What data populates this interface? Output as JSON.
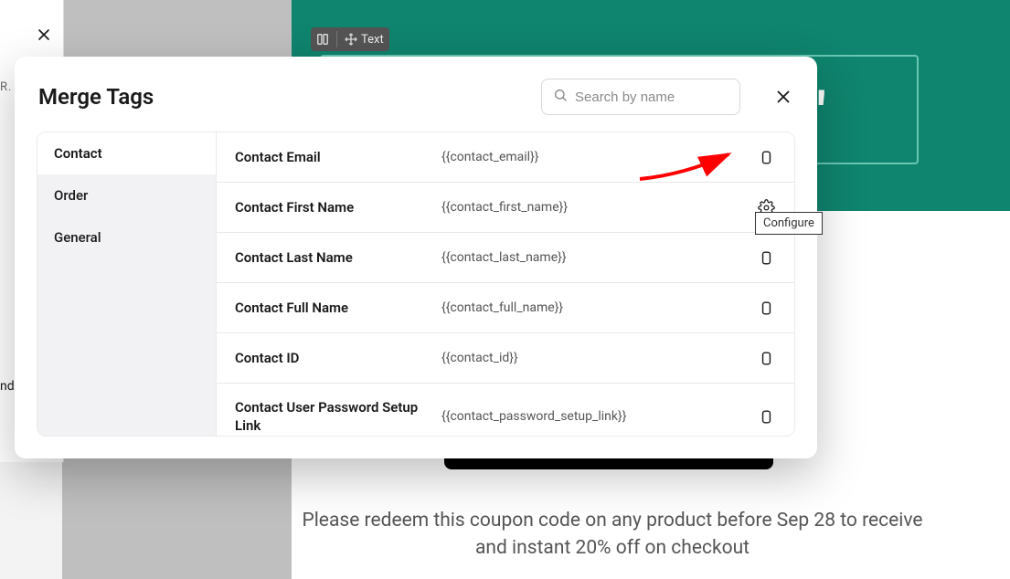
{
  "background": {
    "toolbar_text_label": "Text",
    "caption": "Please redeem this coupon code on any product before Sep 28 to receive and instant 20% off on checkout",
    "truncated_label_top": "R.",
    "truncated_label_mid": "ndi"
  },
  "modal": {
    "title": "Merge Tags",
    "search": {
      "placeholder": "Search by name"
    },
    "sidebar": {
      "items": [
        {
          "label": "Contact",
          "active": true
        },
        {
          "label": "Order",
          "active": false
        },
        {
          "label": "General",
          "active": false
        }
      ]
    },
    "tags": [
      {
        "name": "Contact Email",
        "code": "{{contact_email}}",
        "action": "copy"
      },
      {
        "name": "Contact First Name",
        "code": "{{contact_first_name}}",
        "action": "configure"
      },
      {
        "name": "Contact Last Name",
        "code": "{{contact_last_name}}",
        "action": "copy"
      },
      {
        "name": "Contact Full Name",
        "code": "{{contact_full_name}}",
        "action": "copy"
      },
      {
        "name": "Contact ID",
        "code": "{{contact_id}}",
        "action": "copy"
      },
      {
        "name": "Contact User Password Setup Link",
        "code": "{{contact_password_setup_link}}",
        "action": "copy"
      }
    ]
  },
  "tooltip": {
    "text": "Configure"
  }
}
